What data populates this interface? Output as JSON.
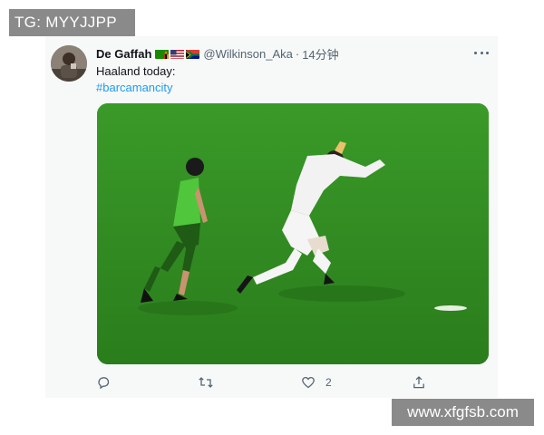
{
  "watermarks": {
    "top": "TG: MYYJJPP",
    "bottom": "www.xfgfsb.com"
  },
  "tweet": {
    "author_name": "De Gaffah",
    "flags": [
      "zambia-flag",
      "us-flag",
      "south-africa-flag"
    ],
    "handle": "@Wilkinson_Aka",
    "separator": "·",
    "time": "14分钟",
    "text": "Haaland today:",
    "hashtag": "#barcamancity",
    "like_count": "2"
  },
  "icons": {
    "reply": "reply-icon",
    "retweet": "retweet-icon",
    "like": "heart-icon",
    "share": "share-icon",
    "more": "more-icon"
  },
  "colors": {
    "accent": "#1d9bf0",
    "pitch": "#2f8a20",
    "card_bg": "#f7f9f9",
    "muted": "#536471"
  }
}
